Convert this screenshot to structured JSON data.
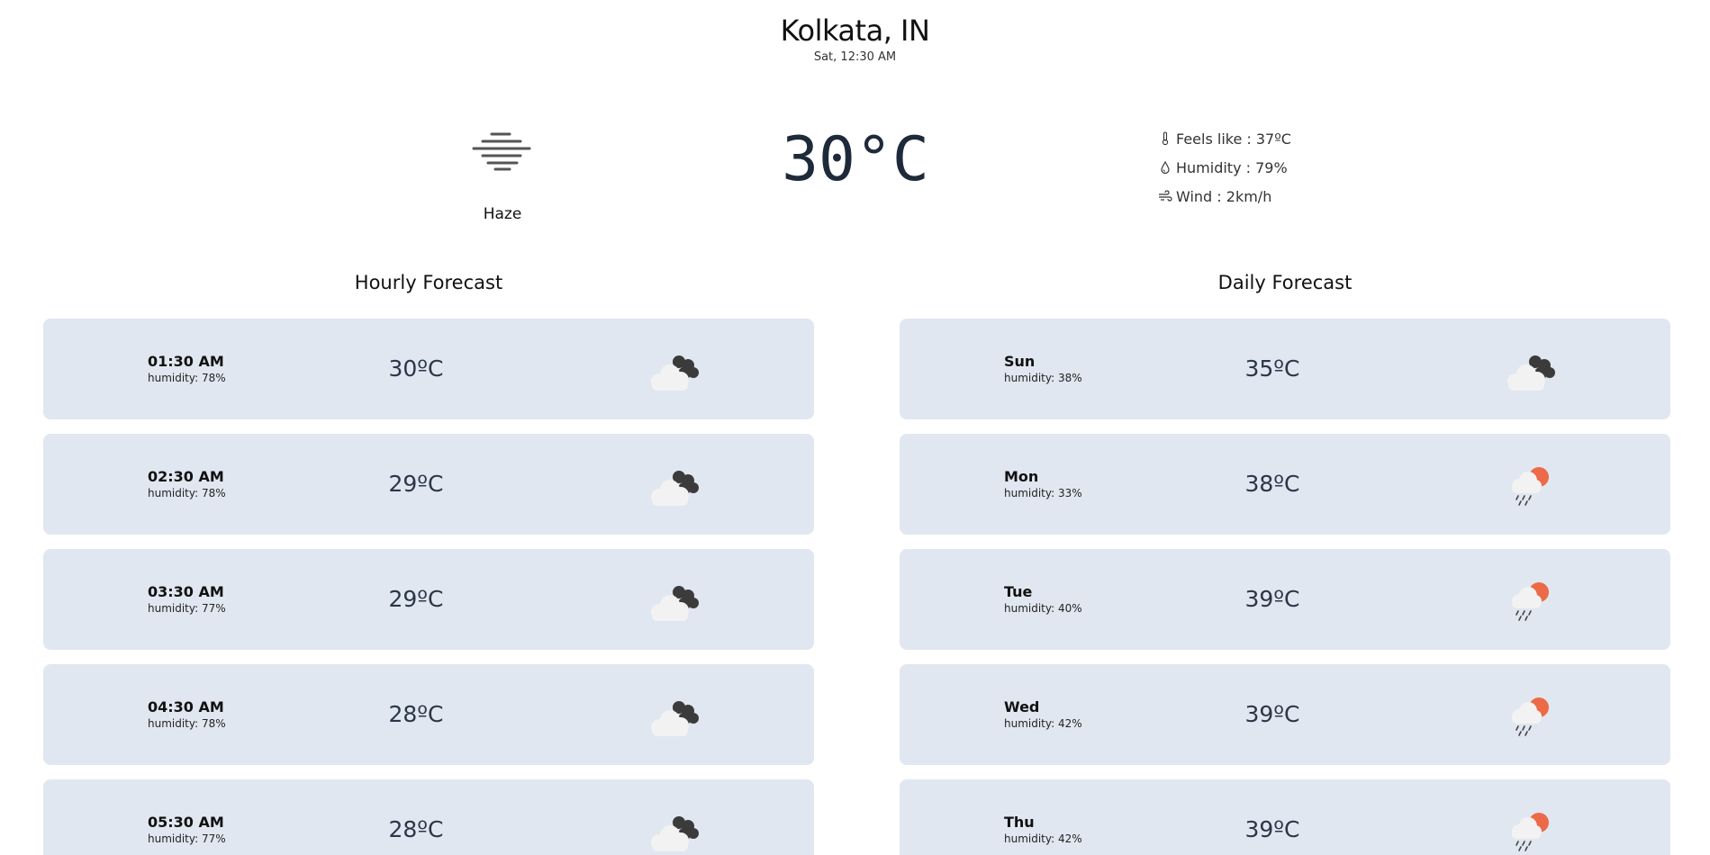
{
  "location": {
    "city": "Kolkata, IN",
    "datetime": "Sat, 12:30 AM"
  },
  "current": {
    "condition": "Haze",
    "condition_icon": "haze-icon",
    "temperature": "30°C",
    "feels_like": "Feels like : 37ºC",
    "humidity": "Humidity : 79%",
    "wind": "Wind : 2km/h",
    "stat_icons": [
      "thermometer-icon",
      "droplet-icon",
      "wind-icon"
    ]
  },
  "hourly": {
    "title": "Hourly Forecast",
    "items": [
      {
        "time": "01:30 AM",
        "humidity": "humidity: 78%",
        "temp": "30ºC",
        "icon": "night-cloudy-icon"
      },
      {
        "time": "02:30 AM",
        "humidity": "humidity: 78%",
        "temp": "29ºC",
        "icon": "night-cloudy-icon"
      },
      {
        "time": "03:30 AM",
        "humidity": "humidity: 77%",
        "temp": "29ºC",
        "icon": "night-cloudy-icon"
      },
      {
        "time": "04:30 AM",
        "humidity": "humidity: 78%",
        "temp": "28ºC",
        "icon": "night-cloudy-icon"
      },
      {
        "time": "05:30 AM",
        "humidity": "humidity: 77%",
        "temp": "28ºC",
        "icon": "night-cloudy-icon"
      }
    ]
  },
  "daily": {
    "title": "Daily Forecast",
    "items": [
      {
        "day": "Sun",
        "humidity": "humidity: 38%",
        "temp": "35ºC",
        "icon": "night-cloudy-icon"
      },
      {
        "day": "Mon",
        "humidity": "humidity: 33%",
        "temp": "38ºC",
        "icon": "sun-rain-icon"
      },
      {
        "day": "Tue",
        "humidity": "humidity: 40%",
        "temp": "39ºC",
        "icon": "sun-rain-icon"
      },
      {
        "day": "Wed",
        "humidity": "humidity: 42%",
        "temp": "39ºC",
        "icon": "sun-rain-icon"
      },
      {
        "day": "Thu",
        "humidity": "humidity: 42%",
        "temp": "39ºC",
        "icon": "sun-rain-icon"
      }
    ]
  },
  "colors": {
    "card_bg": "#e1e7f0",
    "temp_text": "#2b3648",
    "sun": "#ec6a47",
    "cloud_light": "#f2f2f2",
    "cloud_dark": "#3b3b3b"
  }
}
